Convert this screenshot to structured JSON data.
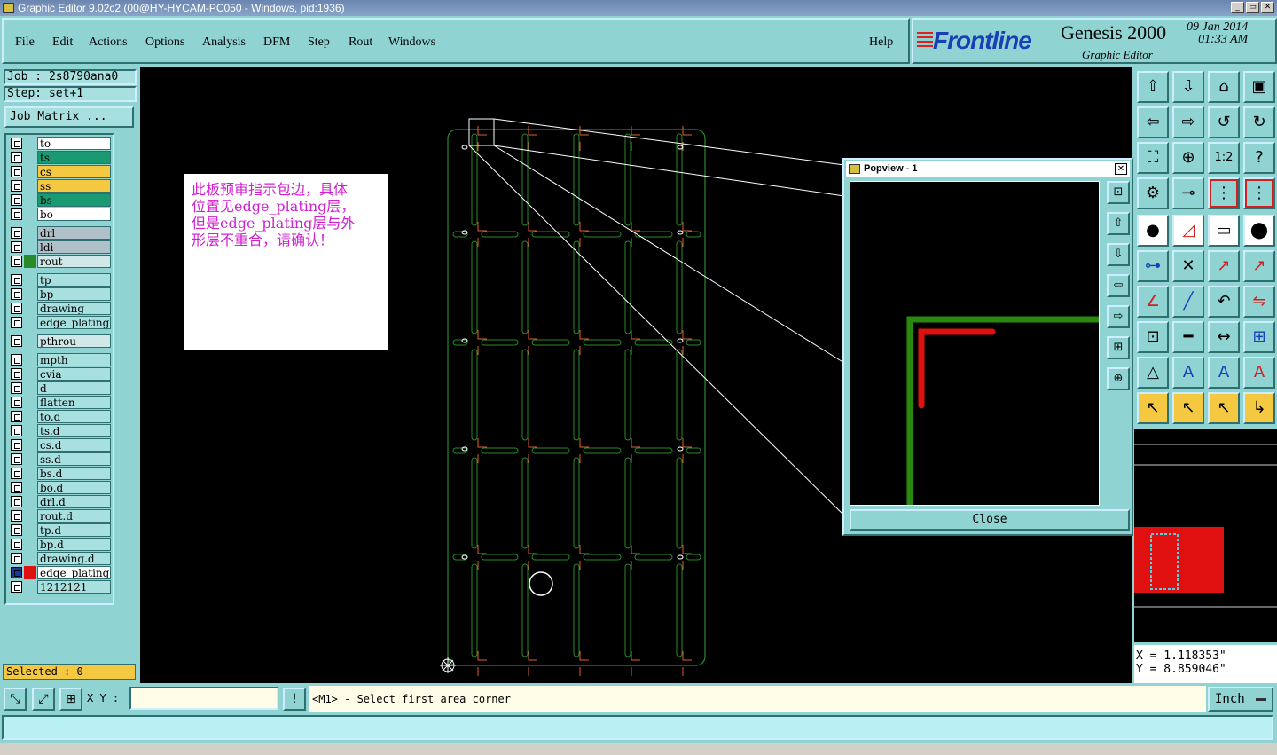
{
  "window": {
    "title": "Graphic Editor 9.02c2 (00@HY-HYCAM-PC050 - Windows, pid:1936)",
    "controls": [
      "_",
      "▭",
      "✕"
    ]
  },
  "menubar": {
    "items": [
      "File",
      "Edit",
      "Actions",
      "Options",
      "Analysis",
      "DFM",
      "Step",
      "Rout",
      "Windows"
    ],
    "help": "Help"
  },
  "brand": {
    "logo": "Frontline",
    "product": "Genesis 2000",
    "subtitle": "Graphic Editor",
    "date": "09 Jan 2014",
    "time": "01:33 AM"
  },
  "job": {
    "job_label": "Job : 2s8790ana0",
    "step_label": "Step: set+1",
    "job_matrix_button": "Job Matrix ..."
  },
  "layers": [
    {
      "name": "to",
      "bg": "#ffffff",
      "color": ""
    },
    {
      "name": "ts",
      "bg": "#1a9a70",
      "color": ""
    },
    {
      "name": "cs",
      "bg": "#f5c842",
      "color": ""
    },
    {
      "name": "ss",
      "bg": "#f5c842",
      "color": ""
    },
    {
      "name": "bs",
      "bg": "#1a9a70",
      "color": ""
    },
    {
      "name": "bo",
      "bg": "#ffffff",
      "color": ""
    },
    {
      "name": "drl",
      "bg": "#b0c0c8",
      "color": ""
    },
    {
      "name": "ldi",
      "bg": "#b0c0c8",
      "color": ""
    },
    {
      "name": "rout",
      "bg": "#d0e8e8",
      "color": "#2a8a2a"
    },
    {
      "name": "tp",
      "bg": "#a8e0e0",
      "color": ""
    },
    {
      "name": "bp",
      "bg": "#a8e0e0",
      "color": ""
    },
    {
      "name": "drawing",
      "bg": "#a8e0e0",
      "color": ""
    },
    {
      "name": "edge_plating",
      "bg": "#a8e0e0",
      "color": ""
    },
    {
      "name": "pthrou",
      "bg": "#d0e8e8",
      "color": ""
    },
    {
      "name": "mpth",
      "bg": "#a8e0e0",
      "color": ""
    },
    {
      "name": "cvia",
      "bg": "#a8e0e0",
      "color": ""
    },
    {
      "name": "d",
      "bg": "#a8e0e0",
      "color": ""
    },
    {
      "name": "flatten",
      "bg": "#a8e0e0",
      "color": ""
    },
    {
      "name": "to.d",
      "bg": "#a8e0e0",
      "color": ""
    },
    {
      "name": "ts.d",
      "bg": "#a8e0e0",
      "color": ""
    },
    {
      "name": "cs.d",
      "bg": "#a8e0e0",
      "color": ""
    },
    {
      "name": "ss.d",
      "bg": "#a8e0e0",
      "color": ""
    },
    {
      "name": "bs.d",
      "bg": "#a8e0e0",
      "color": ""
    },
    {
      "name": "bo.d",
      "bg": "#a8e0e0",
      "color": ""
    },
    {
      "name": "drl.d",
      "bg": "#a8e0e0",
      "color": ""
    },
    {
      "name": "rout.d",
      "bg": "#a8e0e0",
      "color": ""
    },
    {
      "name": "tp.d",
      "bg": "#a8e0e0",
      "color": ""
    },
    {
      "name": "bp.d",
      "bg": "#a8e0e0",
      "color": ""
    },
    {
      "name": "drawing.d",
      "bg": "#a8e0e0",
      "color": ""
    },
    {
      "name": "edge_plating",
      "bg": "#ffffff",
      "color": "#e01010",
      "active": true
    },
    {
      "name": "1212121",
      "bg": "#a8e0e0",
      "color": ""
    }
  ],
  "selected": "Selected : 0",
  "note": {
    "lines": [
      "此板预审指示包边，具体",
      "位置见edge_plating层，",
      "但是edge_plating层与外",
      "形层不重合，请确认！"
    ]
  },
  "popview": {
    "title": "Popview - 1",
    "close": "Close",
    "side_buttons": [
      "popview-zoom",
      "popview-up",
      "popview-down",
      "popview-left",
      "popview-right",
      "popview-fit",
      "popview-center"
    ]
  },
  "tools": [
    [
      "up-arrow-icon",
      "down-arrow-icon",
      "home-icon",
      "window-icon"
    ],
    [
      "left-arrow-icon",
      "right-arrow-icon",
      "undo-zoom-icon",
      "redraw-icon"
    ],
    [
      "fit-icon",
      "center-icon",
      "scale-1-2-icon",
      "question-icon"
    ],
    [
      "settings-icon",
      "snap-icon",
      "layer-red-icon",
      "layer-red2-icon"
    ],
    [
      "point-icon",
      "line-red-icon",
      "measure-icon",
      "pad-icon"
    ],
    [
      "connect-icon",
      "cross-icon",
      "arrow-red-icon",
      "arrow-red2-icon"
    ],
    [
      "angle-icon",
      "slash-icon",
      "arc-icon",
      "compare-icon"
    ],
    [
      "move-icon",
      "minus-icon",
      "dimension-icon",
      "group-icon"
    ],
    [
      "triangle-icon",
      "a-icon",
      "a-box-icon",
      "a-red-icon"
    ],
    [
      "pointer-icon",
      "pointer-box-icon",
      "pointer-red-icon",
      "route-icon"
    ]
  ],
  "coords": {
    "x": "X = 1.118353\"",
    "y": "Y = 8.859046\""
  },
  "bottombar": {
    "xy_label": "X Y :",
    "xy_value": "",
    "prompt": "<M1> - Select first area corner",
    "unit": "Inch"
  },
  "colors": {
    "panel": "#8fd3d3",
    "outline": "#2a8a2a",
    "edge_plating": "#e01010"
  }
}
